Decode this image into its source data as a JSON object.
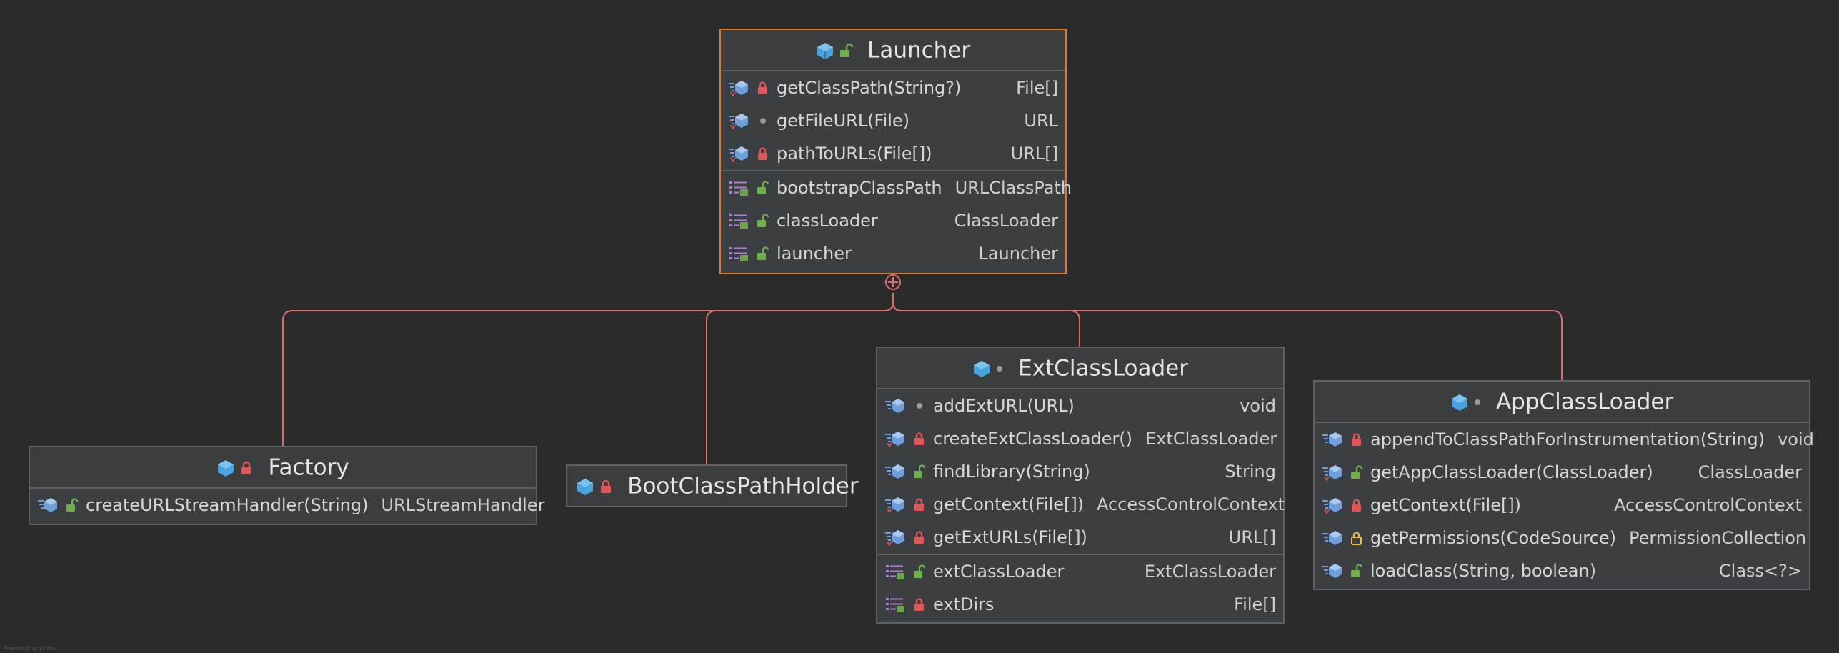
{
  "colors": {
    "background": "#2b2b2b",
    "box_fill": "#3c3f41",
    "box_border": "#5f6062",
    "selected_border": "#e07b24",
    "connector": "#e06c6c",
    "class_icon": "#4aa3df",
    "method_icon": "#6f9fdb",
    "field_icon": "#b07cd8",
    "lock_private": "#e05555",
    "lock_public": "#6fb04c",
    "lock_protected": "#e2c04d"
  },
  "launcher": {
    "title": "Launcher",
    "visibility": "public",
    "methods": [
      {
        "name": "getClassPath(String?)",
        "type": "File[]",
        "icon": "static-method-icon",
        "visibility": "private"
      },
      {
        "name": "getFileURL(File)",
        "type": "URL",
        "icon": "static-method-icon",
        "visibility": "package"
      },
      {
        "name": "pathToURLs(File[])",
        "type": "URL[]",
        "icon": "static-method-icon",
        "visibility": "private"
      }
    ],
    "fields": [
      {
        "name": "bootstrapClassPath",
        "type": "URLClassPath",
        "icon": "field-icon",
        "visibility": "public"
      },
      {
        "name": "classLoader",
        "type": "ClassLoader",
        "icon": "field-icon",
        "visibility": "public"
      },
      {
        "name": "launcher",
        "type": "Launcher",
        "icon": "field-icon",
        "visibility": "public"
      }
    ]
  },
  "factory": {
    "title": "Factory",
    "visibility": "private",
    "methods": [
      {
        "name": "createURLStreamHandler(String)",
        "type": "URLStreamHandler",
        "icon": "method-icon",
        "visibility": "public"
      }
    ]
  },
  "bootClassPathHolder": {
    "title": "BootClassPathHolder",
    "visibility": "private"
  },
  "extClassLoader": {
    "title": "ExtClassLoader",
    "visibility": "package",
    "methods": [
      {
        "name": "addExtURL(URL)",
        "type": "void",
        "icon": "method-icon",
        "visibility": "package"
      },
      {
        "name": "createExtClassLoader()",
        "type": "ExtClassLoader",
        "icon": "static-method-icon",
        "visibility": "private"
      },
      {
        "name": "findLibrary(String)",
        "type": "String",
        "icon": "method-icon",
        "visibility": "public"
      },
      {
        "name": "getContext(File[])",
        "type": "AccessControlContext",
        "icon": "static-method-icon",
        "visibility": "private"
      },
      {
        "name": "getExtURLs(File[])",
        "type": "URL[]",
        "icon": "static-method-icon",
        "visibility": "private"
      }
    ],
    "fields": [
      {
        "name": "extClassLoader",
        "type": "ExtClassLoader",
        "icon": "field-icon",
        "visibility": "public"
      },
      {
        "name": "extDirs",
        "type": "File[]",
        "icon": "field-icon",
        "visibility": "private"
      }
    ]
  },
  "appClassLoader": {
    "title": "AppClassLoader",
    "visibility": "package",
    "methods": [
      {
        "name": "appendToClassPathForInstrumentation(String)",
        "type": "void",
        "icon": "method-icon",
        "visibility": "private"
      },
      {
        "name": "getAppClassLoader(ClassLoader)",
        "type": "ClassLoader",
        "icon": "static-method-icon",
        "visibility": "public"
      },
      {
        "name": "getContext(File[])",
        "type": "AccessControlContext",
        "icon": "static-method-icon",
        "visibility": "private"
      },
      {
        "name": "getPermissions(CodeSource)",
        "type": "PermissionCollection",
        "icon": "method-icon",
        "visibility": "protected"
      },
      {
        "name": "loadClass(String, boolean)",
        "type": "Class<?>",
        "icon": "method-icon",
        "visibility": "public"
      }
    ]
  },
  "watermark": "Powered by yFiles"
}
